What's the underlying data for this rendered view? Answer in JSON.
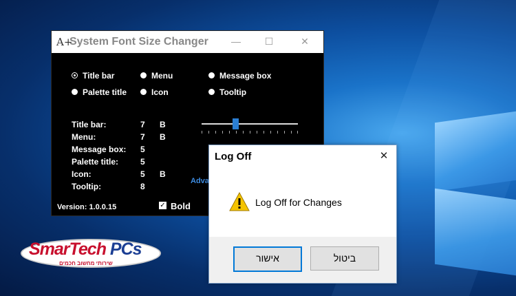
{
  "fsc_window": {
    "title": "System Font Size Changer",
    "title_icon": "A+",
    "controls": {
      "minimize": "—",
      "maximize": "☐",
      "close": "✕"
    },
    "radios": [
      {
        "label": "Title bar",
        "selected": true
      },
      {
        "label": "Menu",
        "selected": false
      },
      {
        "label": "Message box",
        "selected": false
      },
      {
        "label": "Palette title",
        "selected": false
      },
      {
        "label": "Icon",
        "selected": false
      },
      {
        "label": "Tooltip",
        "selected": false
      }
    ],
    "rows": [
      {
        "label": "Title bar:",
        "value": "7",
        "bold": "B"
      },
      {
        "label": "Menu:",
        "value": "7",
        "bold": "B"
      },
      {
        "label": "Message box:",
        "value": "5",
        "bold": ""
      },
      {
        "label": "Palette title:",
        "value": "5",
        "bold": ""
      },
      {
        "label": "Icon:",
        "value": "5",
        "bold": "B"
      },
      {
        "label": "Tooltip:",
        "value": "8",
        "bold": ""
      }
    ],
    "advanced_link": "Adva",
    "version": "Version: 1.0.0.15",
    "bold_checkbox": {
      "label": "Bold",
      "checked": true,
      "mark": "✓"
    }
  },
  "dialog": {
    "title": "Log Off",
    "close": "✕",
    "message": "Log Off for Changes",
    "ok_label": "אישור",
    "cancel_label": "ביטול"
  },
  "brand": {
    "name_red": "SmarTech",
    "name_blue": " PCs",
    "tagline": "שירותי מחשוב חכמים"
  },
  "colors": {
    "accent": "#0078d7",
    "warning": "#f5c400",
    "brand_red": "#c8102e",
    "brand_blue": "#1c3f94"
  }
}
